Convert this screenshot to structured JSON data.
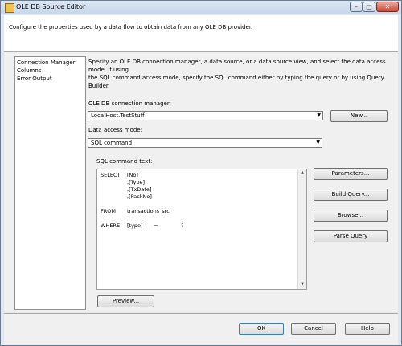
{
  "window": {
    "title": "OLE DB Source Editor"
  },
  "header": {
    "text": "Configure the properties used by a data flow to obtain data from any OLE DB provider."
  },
  "nav": {
    "items": [
      "Connection Manager",
      "Columns",
      "Error Output"
    ]
  },
  "connection": {
    "description_line1": "Specify an OLE DB connection manager, a data source, or a data source view, and select the data access mode. If using",
    "description_line2": "the SQL command access mode, specify the SQL command either by typing the query or by using Query Builder.",
    "manager_label": "OLE DB connection manager:",
    "manager_value": "LocalHost.TestStuff",
    "new_label": "New...",
    "access_label": "Data access mode:",
    "access_value": "SQL command",
    "sql_label": "SQL command text:"
  },
  "sql": {
    "select_kw": "SELECT",
    "col1": "[No]",
    "col2": ",[Type]",
    "col3": ",[TxDate]",
    "col4": ",[PackNo]",
    "from_kw": "FROM",
    "table": "transactions_src",
    "where_kw": "WHERE",
    "where_col": "[type]",
    "where_op": "=",
    "where_param": "?"
  },
  "side_buttons": {
    "parameters": "Parameters...",
    "build_query": "Build Query...",
    "browse": "Browse...",
    "parse_query": "Parse Query"
  },
  "preview_label": "Preview...",
  "footer": {
    "ok": "OK",
    "cancel": "Cancel",
    "help": "Help"
  }
}
